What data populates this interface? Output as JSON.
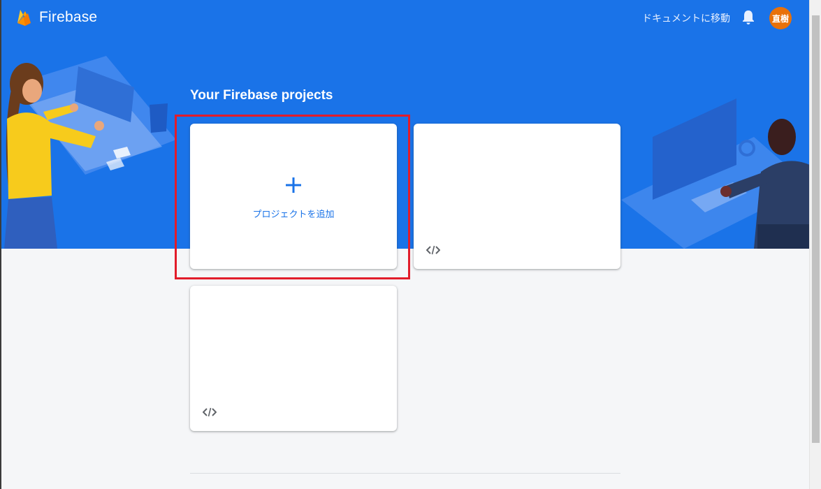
{
  "app": {
    "title": "Firebase",
    "logo_icon": "firebase-flame-icon"
  },
  "header": {
    "docs_link": "ドキュメントに移動",
    "notifications_icon": "bell-icon",
    "avatar_text": "直樹"
  },
  "main": {
    "heading": "Your Firebase projects",
    "add_project": {
      "icon": "plus-icon",
      "label": "プロジェクトを追加"
    },
    "projects": [
      {
        "name": "",
        "platform_icon": "code-icon"
      },
      {
        "name": "",
        "platform_icon": "code-icon"
      }
    ]
  },
  "colors": {
    "hero": "#1a73e8",
    "background": "#f5f6f8",
    "accent": "#1a73e8",
    "avatar": "#e8710a",
    "highlight": "#e21c2a"
  }
}
